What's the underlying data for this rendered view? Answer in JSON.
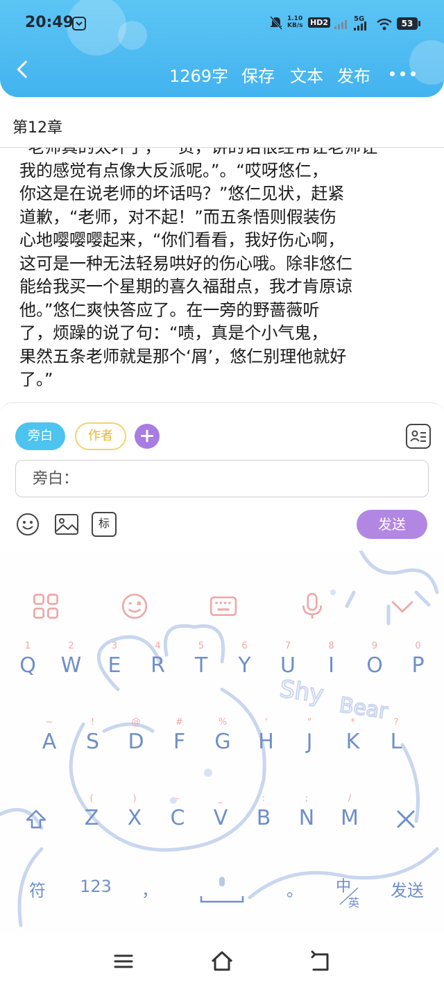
{
  "status": {
    "time": "20:49",
    "net_speed": "1.10\nKB/s",
    "hd": "HD2",
    "signal_label": "5G",
    "battery": "53"
  },
  "header": {
    "word_count": "1269字",
    "save": "保存",
    "text": "文本",
    "publish": "发布"
  },
  "chapter": {
    "title": "第12章"
  },
  "content": {
    "text": "“老师真的太坏了，一贯，讲的话很经常让老师让\n我的感觉有点像大反派呢。”。“哎呀悠仁，\n你这是在说老师的坏话吗？”悠仁见状，赶紧\n道歉，“老师，对不起！”而五条悟则假装伤\n心地嘤嘤嘤起来，“你们看看，我好伤心啊，\n这可是一种无法轻易哄好的伤心哦。除非悠仁\n能给我买一个星期的喜久福甜点，我才肯原谅\n他。”悠仁爽快答应了。在一旁的野蔷薇听\n了，烦躁的说了句：“啧，真是个小气鬼，\n果然五条老师就是那个‘屑’，悠仁别理他就好\n了。”"
  },
  "composer": {
    "role_narration": "旁白",
    "role_author": "作者",
    "input_placeholder": "旁白：",
    "tag_label": "标",
    "send": "发送"
  },
  "keyboard": {
    "row1": [
      {
        "sub": "1",
        "key": "Q"
      },
      {
        "sub": "2",
        "key": "W"
      },
      {
        "sub": "3",
        "key": "E"
      },
      {
        "sub": "4",
        "key": "R"
      },
      {
        "sub": "5",
        "key": "T"
      },
      {
        "sub": "6",
        "key": "Y"
      },
      {
        "sub": "7",
        "key": "U"
      },
      {
        "sub": "8",
        "key": "I"
      },
      {
        "sub": "9",
        "key": "O"
      },
      {
        "sub": "0",
        "key": "P"
      }
    ],
    "row2": [
      {
        "sub": "~",
        "key": "A"
      },
      {
        "sub": "!",
        "key": "S"
      },
      {
        "sub": "@",
        "key": "D"
      },
      {
        "sub": "#",
        "key": "F"
      },
      {
        "sub": "%",
        "key": "G"
      },
      {
        "sub": "'",
        "key": "H"
      },
      {
        "sub": "\"",
        "key": "J"
      },
      {
        "sub": "*",
        "key": "K"
      },
      {
        "sub": "?",
        "key": "L"
      }
    ],
    "row3": [
      {
        "sub": "(",
        "key": "Z"
      },
      {
        "sub": ")",
        "key": "X"
      },
      {
        "sub": "-",
        "key": "C"
      },
      {
        "sub": "_",
        "key": "V"
      },
      {
        "sub": ":",
        "key": "B"
      },
      {
        "sub": ";",
        "key": "N"
      },
      {
        "sub": "/",
        "key": "M"
      }
    ],
    "symbols": "符",
    "numbers": "123",
    "comma": "，",
    "period": "。",
    "lang_zh": "中",
    "lang_en": "英",
    "send": "发送",
    "deco_text_1": "Shy",
    "deco_text_2": "Bear"
  },
  "colors": {
    "header_blue": "#4bb9f1",
    "chip_blue": "#4dc3ef",
    "send_purple": "#b287e3",
    "key_blue": "#6e8fc9",
    "key_sub_pink": "#f0a7a7"
  }
}
